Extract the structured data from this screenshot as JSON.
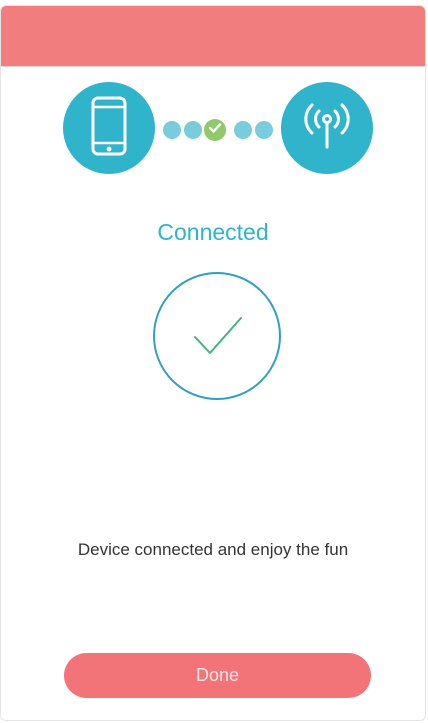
{
  "status": {
    "title": "Connected",
    "message": "Device connected and enjoy the fun"
  },
  "actions": {
    "done_label": "Done"
  },
  "icons": {
    "left": "phone-icon",
    "right": "wireless-signal-icon",
    "progress": "check-icon",
    "result": "check-icon"
  },
  "colors": {
    "header": "#f27d7f",
    "accent": "#2fb4cc",
    "progress_dot": "#78ccdc",
    "success": "#8fc96a",
    "check_stroke": "#3fb57e",
    "button": "#f27478"
  }
}
